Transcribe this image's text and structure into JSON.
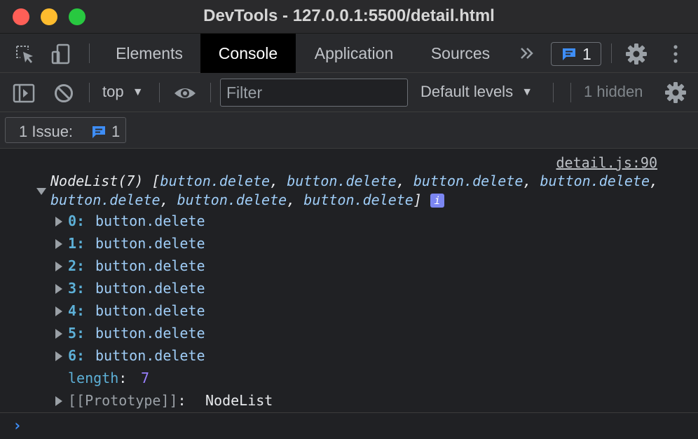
{
  "window": {
    "title": "DevTools - 127.0.0.1:5500/detail.html"
  },
  "tabs": [
    {
      "label": "Elements"
    },
    {
      "label": "Console"
    },
    {
      "label": "Application"
    },
    {
      "label": "Sources"
    }
  ],
  "header": {
    "more_tabs_icon": "chevrons-right-icon",
    "issues_count": "1"
  },
  "console_toolbar": {
    "context": "top",
    "filter_placeholder": "Filter",
    "levels": "Default levels",
    "hidden": "1 hidden"
  },
  "issues_bar": {
    "label": "1 Issue:",
    "count": "1"
  },
  "output": {
    "source": "detail.js:90",
    "summary_prefix": "NodeList(7) [",
    "summary_items": [
      "button.delete",
      "button.delete",
      "button.delete",
      "button.delete",
      "button.delete",
      "button.delete",
      "button.delete"
    ],
    "summary_suffix": "]",
    "info_icon": "i",
    "entries": [
      {
        "index": "0:",
        "value": "button.delete"
      },
      {
        "index": "1:",
        "value": "button.delete"
      },
      {
        "index": "2:",
        "value": "button.delete"
      },
      {
        "index": "3:",
        "value": "button.delete"
      },
      {
        "index": "4:",
        "value": "button.delete"
      },
      {
        "index": "5:",
        "value": "button.delete"
      },
      {
        "index": "6:",
        "value": "button.delete"
      }
    ],
    "length_key": "length",
    "length_value": "7",
    "prototype_key": "[[Prototype]]",
    "prototype_value": "NodeList"
  },
  "prompt": {
    "caret": "›"
  },
  "colors": {
    "accent": "#3e8ef7",
    "active_tab_bg": "#000000",
    "info_badge": "#7b86f2"
  }
}
